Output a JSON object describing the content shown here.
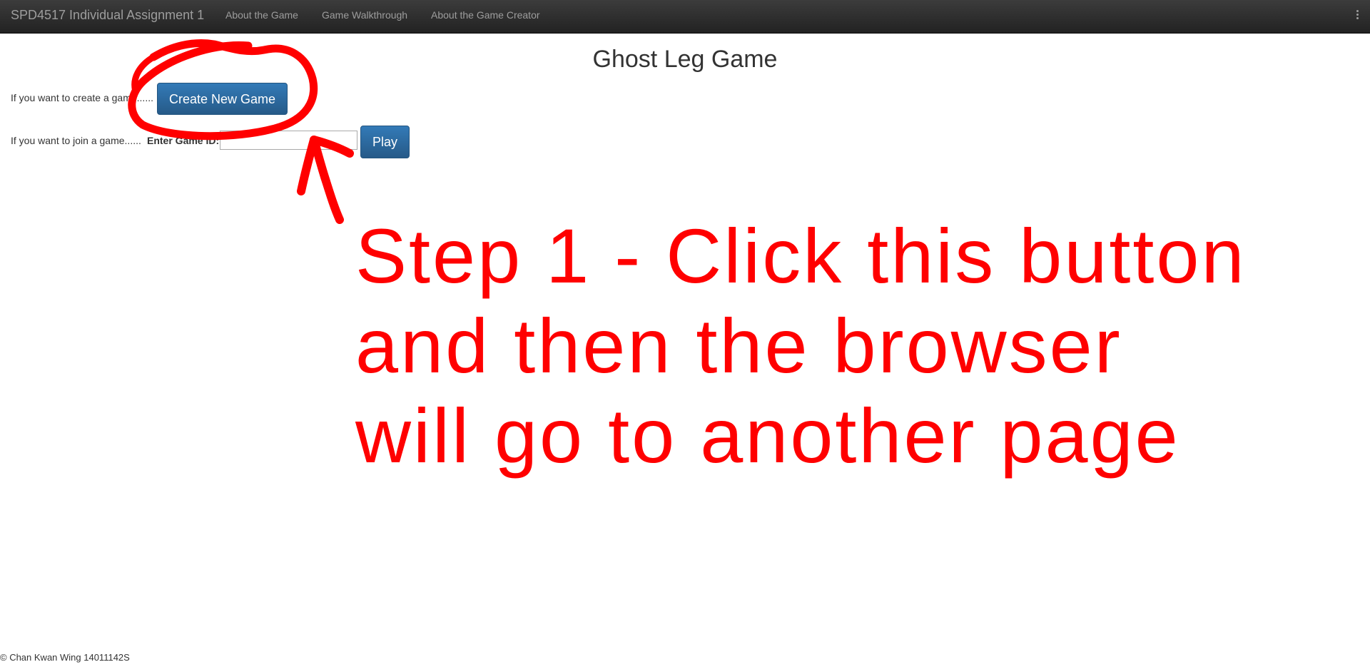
{
  "navbar": {
    "brand": "SPD4517 Individual Assignment 1",
    "links": [
      {
        "label": "About the Game"
      },
      {
        "label": "Game Walkthrough"
      },
      {
        "label": "About the Game Creator"
      }
    ],
    "menu_icon": "kebab-menu-icon"
  },
  "main": {
    "title": "Ghost Leg Game",
    "create_row": {
      "prompt": "If you want to create a game......",
      "button_label": "Create New Game"
    },
    "join_row": {
      "prompt": "If you want to join a game......",
      "field_label": "Enter Game ID:",
      "field_value": "",
      "button_label": "Play"
    }
  },
  "annotation": {
    "text": "Step 1 - Click this button and then the browser will go to another page",
    "color": "#ff0000"
  },
  "footer": {
    "text": "© Chan Kwan Wing 14011142S"
  },
  "colors": {
    "navbar_bg": "#222222",
    "primary_button": "#337ab7",
    "annotation_red": "#ff0000"
  }
}
